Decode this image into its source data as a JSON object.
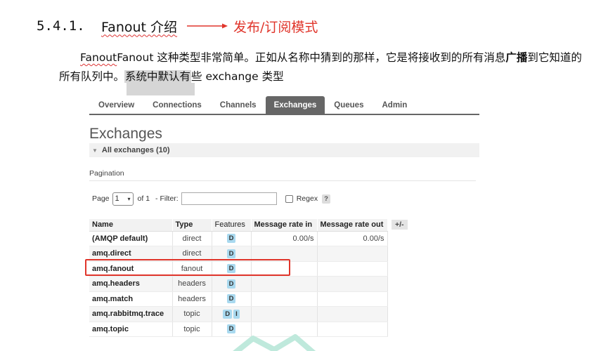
{
  "heading": {
    "number": "5.4.1.",
    "title": "Fanout 介绍",
    "note": "发布/订阅模式",
    "accent_color": "#e0352b"
  },
  "paragraph": {
    "line1_a": "Fanout 这种类型非常简单。正如从名称中猜到的那样，它是将接收到的所有消息",
    "line1_bold": "广播",
    "line1_b": "到它知道的",
    "line2_a": "所有队列中。",
    "line2_highlight": "系统中默认有",
    "line2_b": "些 exchange 类型"
  },
  "rabbitmq": {
    "tabs": [
      "Overview",
      "Connections",
      "Channels",
      "Exchanges",
      "Queues",
      "Admin"
    ],
    "active_tab": "Exchanges",
    "page_title": "Exchanges",
    "section_toggle": "All exchanges (10)",
    "pagination_label": "Pagination",
    "page_label": "Page",
    "page_value": "1",
    "of_label": "of 1",
    "filter_label": "- Filter:",
    "filter_value": "",
    "regex_label": "Regex",
    "help_label": "?",
    "columns_toggle": "+/-",
    "table": {
      "headers": [
        "Name",
        "Type",
        "Features",
        "Message rate in",
        "Message rate out"
      ],
      "rows": [
        {
          "name": "(AMQP default)",
          "type": "direct",
          "features": [
            "D"
          ],
          "rate_in": "0.00/s",
          "rate_out": "0.00/s"
        },
        {
          "name": "amq.direct",
          "type": "direct",
          "features": [
            "D"
          ],
          "rate_in": "",
          "rate_out": ""
        },
        {
          "name": "amq.fanout",
          "type": "fanout",
          "features": [
            "D"
          ],
          "rate_in": "",
          "rate_out": ""
        },
        {
          "name": "amq.headers",
          "type": "headers",
          "features": [
            "D"
          ],
          "rate_in": "",
          "rate_out": ""
        },
        {
          "name": "amq.match",
          "type": "headers",
          "features": [
            "D"
          ],
          "rate_in": "",
          "rate_out": ""
        },
        {
          "name": "amq.rabbitmq.trace",
          "type": "topic",
          "features": [
            "D",
            "I"
          ],
          "rate_in": "",
          "rate_out": ""
        },
        {
          "name": "amq.topic",
          "type": "topic",
          "features": [
            "D"
          ],
          "rate_in": "",
          "rate_out": ""
        }
      ]
    },
    "highlighted_row": "amq.fanout"
  }
}
